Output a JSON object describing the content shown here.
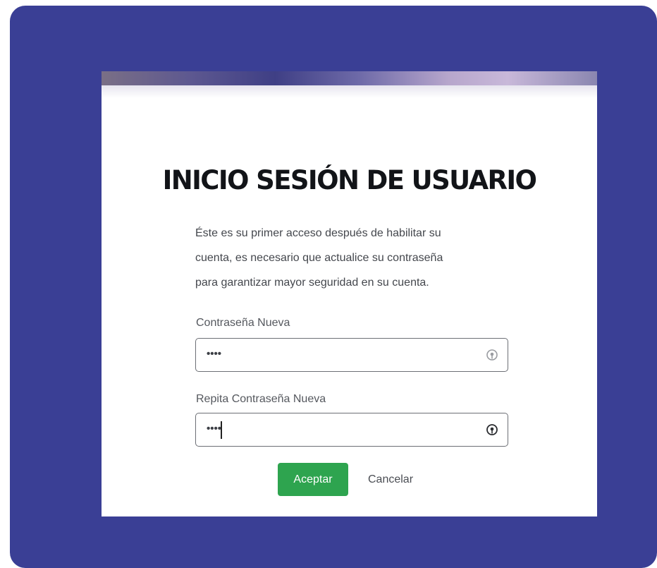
{
  "dialog": {
    "title": "INICIO SESIÓN DE USUARIO",
    "description_lines": [
      "Éste es su primer acceso después de habilitar su",
      "cuenta, es necesario que actualice su contraseña",
      "para garantizar mayor seguridad en su cuenta."
    ]
  },
  "form": {
    "new_password": {
      "label": "Contraseña Nueva",
      "value": "••••",
      "icon": "eye-icon"
    },
    "repeat_password": {
      "label": "Repita Contraseña Nueva",
      "value": "••••",
      "icon": "eye-icon"
    }
  },
  "actions": {
    "accept_label": "Aceptar",
    "cancel_label": "Cancelar"
  },
  "colors": {
    "background_frame": "#3a3f95",
    "accept_button": "#2ea44f"
  }
}
